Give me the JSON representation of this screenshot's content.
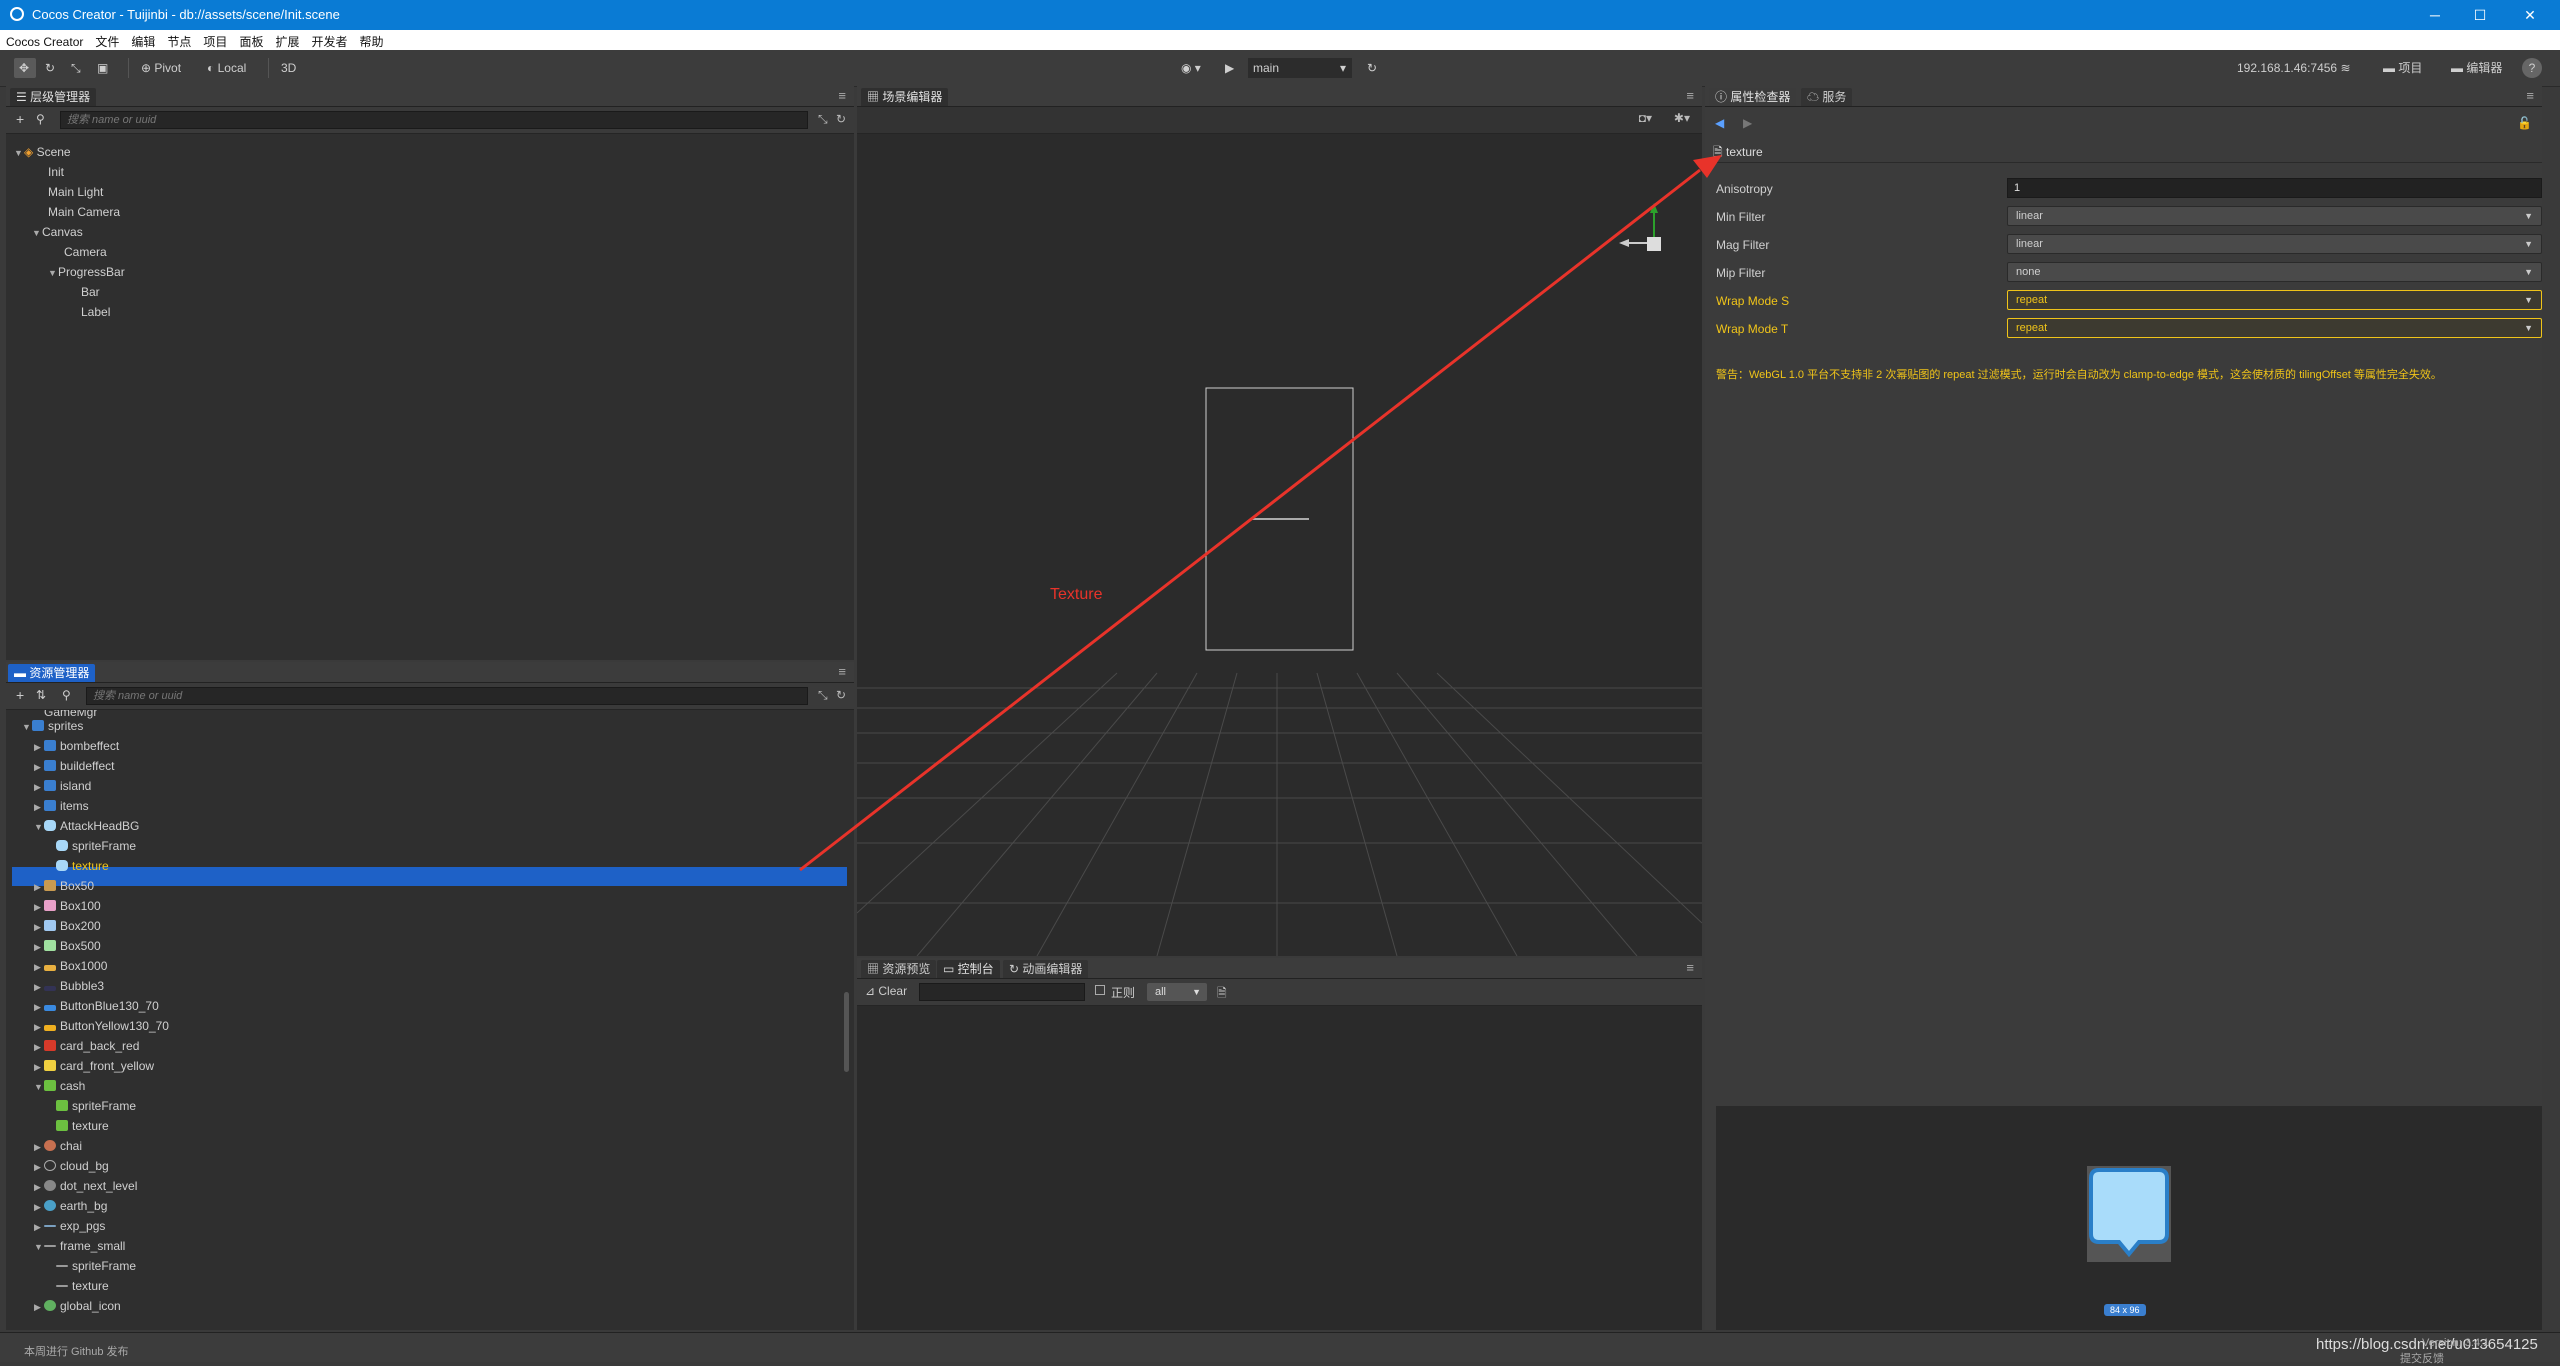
{
  "window": {
    "title": "Cocos Creator - Tuijinbi - db://assets/scene/Init.scene",
    "controls": {
      "minimize": "─",
      "maximize": "☐",
      "close": "✕"
    }
  },
  "menu": [
    "Cocos Creator",
    "文件",
    "编辑",
    "节点",
    "项目",
    "面板",
    "扩展",
    "开发者",
    "帮助"
  ],
  "toolbar": {
    "pivot": "Pivot",
    "local": "Local",
    "three_d": "3D",
    "platform": "main",
    "ip": "192.168.1.46:7456",
    "project": "项目",
    "editor": "编辑器",
    "help": "?"
  },
  "hierarchy": {
    "tab": "层级管理器",
    "search_placeholder": "搜索 name or uuid",
    "nodes": [
      "Scene",
      "Init",
      "Main Light",
      "Main Camera",
      "Canvas",
      "Camera",
      "ProgressBar",
      "Bar",
      "Label"
    ]
  },
  "assets": {
    "tab": "资源管理器",
    "search_placeholder": "搜索 name or uuid",
    "items": [
      "GameMgr",
      "sprites",
      "bombeffect",
      "buildeffect",
      "island",
      "items",
      "AttackHeadBG",
      "spriteFrame",
      "texture",
      "Box50",
      "Box100",
      "Box200",
      "Box500",
      "Box1000",
      "Bubble3",
      "ButtonBlue130_70",
      "ButtonYellow130_70",
      "card_back_red",
      "card_front_yellow",
      "cash",
      "spriteFrame",
      "texture",
      "chai",
      "cloud_bg",
      "dot_next_level",
      "earth_bg",
      "exp_pgs",
      "frame_small",
      "spriteFrame",
      "texture",
      "global_icon"
    ]
  },
  "scene": {
    "tab": "场景编辑器",
    "annotation": "Texture"
  },
  "console": {
    "tabs": [
      "资源预览",
      "控制台",
      "动画编辑器"
    ],
    "clear": "Clear",
    "regex": "正则",
    "level": "all"
  },
  "inspector": {
    "tabs": [
      "属性检查器",
      "服务"
    ],
    "asset_name": "texture",
    "props": [
      {
        "label": "Anisotropy",
        "value": "1"
      },
      {
        "label": "Min Filter",
        "value": "linear"
      },
      {
        "label": "Mag Filter",
        "value": "linear"
      },
      {
        "label": "Mip Filter",
        "value": "none"
      },
      {
        "label": "Wrap Mode S",
        "value": "repeat"
      },
      {
        "label": "Wrap Mode T",
        "value": "repeat"
      }
    ],
    "warning": "警告：WebGL 1.0 平台不支持非 2 次幂贴图的 repeat 过滤模式，运行时会自动改为 clamp-to-edge 模式，这会使材质的 tilingOffset 等属性完全失效。",
    "preview_size": "84 x 96"
  },
  "status": {
    "left": "本周进行 Github 发布",
    "watermark": "https://blog.csdn.net/u013654125",
    "version": "Version: 3.4.1",
    "right": "提交反馈"
  },
  "colors": {
    "accent": "#1e61c7",
    "warning": "#f0c419",
    "annotation": "#e8332a"
  }
}
